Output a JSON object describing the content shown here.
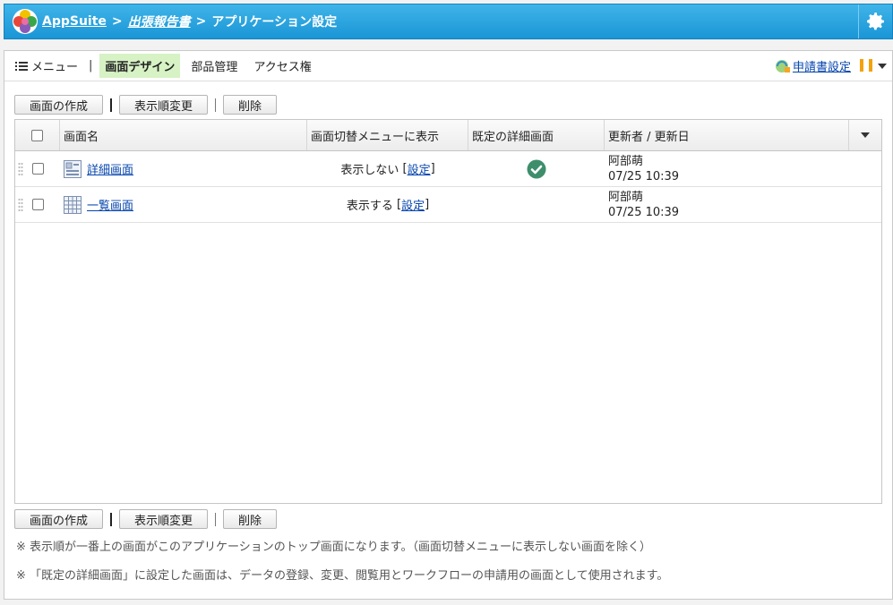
{
  "header": {
    "app_name": "AppSuite",
    "separator": ">",
    "report_name": "出張報告書",
    "page_title": "アプリケーション設定"
  },
  "tabs": {
    "menu_label": "メニュー",
    "divider": "|",
    "items": [
      {
        "label": "画面デザイン",
        "active": true
      },
      {
        "label": "部品管理",
        "active": false
      },
      {
        "label": "アクセス権",
        "active": false
      }
    ],
    "apply_settings": "申請書設定"
  },
  "toolbar": {
    "create": "画面の作成",
    "reorder": "表示順変更",
    "delete": "削除"
  },
  "grid": {
    "columns": [
      "画面名",
      "画面切替メニューに表示",
      "既定の詳細画面",
      "更新者 / 更新日"
    ],
    "rows": [
      {
        "name": "詳細画面",
        "icon": "detail-screen-icon",
        "menu_text": "表示しない",
        "menu_link": "設定",
        "is_default": true,
        "updater": "阿部萌",
        "updated": "07/25 10:39"
      },
      {
        "name": "一覧画面",
        "icon": "list-screen-icon",
        "menu_text": "表示する",
        "menu_link": "設定",
        "is_default": false,
        "updater": "阿部萌",
        "updated": "07/25 10:39"
      }
    ]
  },
  "notes": {
    "n1": "※ 表示順が一番上の画面がこのアプリケーションのトップ画面になります。（画面切替メニューに表示しない画面を除く）",
    "n2": "※ 「既定の詳細画面」に設定した画面は、データの登録、変更、閲覧用とワークフローの申請用の画面として使用されます。"
  },
  "colors": {
    "header": "#1a95d6",
    "active_tab": "#d7f2c4",
    "link": "#0645ad",
    "default_check": "#3e8e6c",
    "pause": "#f2a20c"
  }
}
